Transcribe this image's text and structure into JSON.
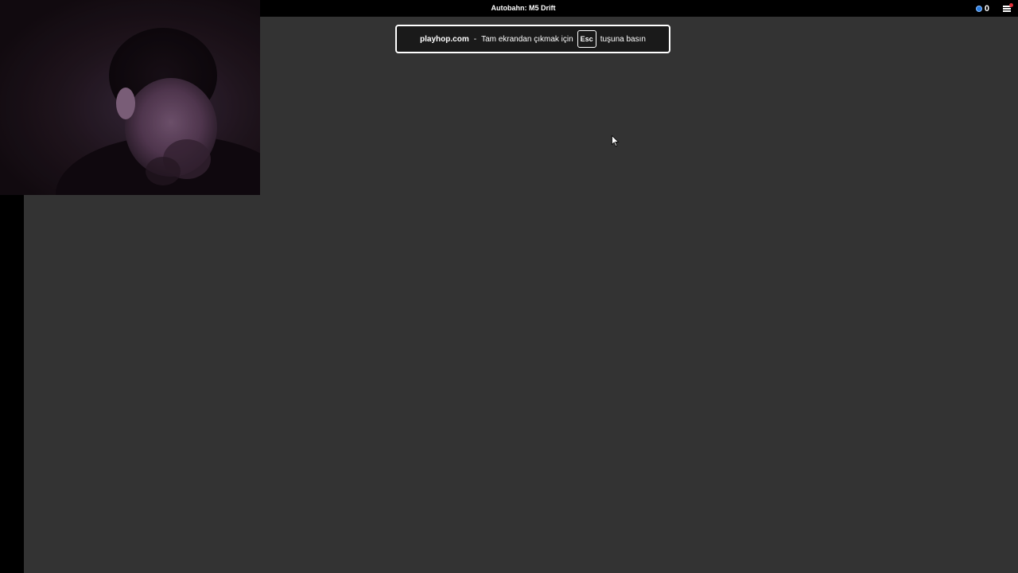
{
  "topbar": {
    "title": "Autobahn: M5 Drift",
    "coins": "0"
  },
  "fullscreen_notice": {
    "domain": "playhop.com",
    "separator": "-",
    "message_before": "Tam ekrandan çıkmak için",
    "key": "Esc",
    "message_after": "tuşuna basın"
  },
  "colors": {
    "game_background": "#333333",
    "chrome_background": "#000000",
    "coin_blue": "#2a7de1",
    "notification_red": "#e0303a"
  },
  "icons": {
    "coin": "coin-icon",
    "menu": "hamburger-menu-icon",
    "cursor": "mouse-pointer-icon"
  }
}
